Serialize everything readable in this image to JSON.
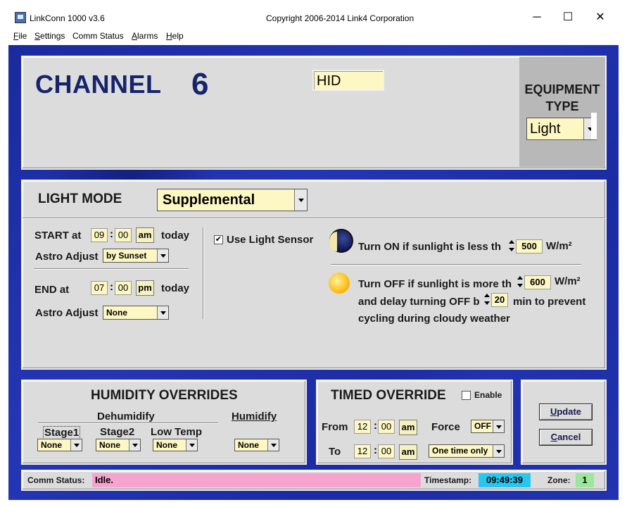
{
  "window": {
    "title": "LinkConn 1000 v3.6",
    "copyright": "Copyright 2006-2014 Link4 Corporation",
    "minimize": "─",
    "maximize": "☐",
    "close": "✕"
  },
  "menu": [
    {
      "label": "File",
      "key": "F",
      "rest": "ile"
    },
    {
      "label": "Settings",
      "key": "S",
      "rest": "ettings"
    },
    {
      "label": "Comm Status",
      "key": "",
      "rest": "Comm Status"
    },
    {
      "label": "Alarms",
      "key": "A",
      "rest": "larms"
    },
    {
      "label": "Help",
      "key": "H",
      "rest": "elp"
    }
  ],
  "channel": {
    "title": "CHANNEL",
    "number": "6",
    "name_value": "HID",
    "equipment_type_label_1": "EQUIPMENT",
    "equipment_type_label_2": "TYPE",
    "equipment_type_value": "Light"
  },
  "light_mode": {
    "label": "LIGHT MODE",
    "value": "Supplemental",
    "start": {
      "label": "START at",
      "hour": "09",
      "minute": "00",
      "ampm": "am",
      "suffix": "today",
      "astro_label": "Astro Adjust",
      "astro_value": "by Sunset"
    },
    "end": {
      "label": "END at",
      "hour": "07",
      "minute": "00",
      "ampm": "pm",
      "suffix": "today",
      "astro_label": "Astro Adjust",
      "astro_value": "None"
    },
    "sensor": {
      "checkbox_mark": "✔",
      "checked": true,
      "label": "Use Light Sensor",
      "on_text": "Turn ON if sunlight is less th",
      "on_value": "500",
      "on_unit": "W/m²",
      "off_text": "Turn OFF if sunlight is more th",
      "off_value": "600",
      "off_unit": "W/m²",
      "delay_text": "and delay turning OFF b",
      "delay_value": "20",
      "delay_suffix": "min to prevent",
      "delay_line2": "cycling during cloudy weather"
    }
  },
  "humidity": {
    "title": "HUMIDITY OVERRIDES",
    "dehumidify_label": "Dehumidify",
    "humidify_label": "Humidify",
    "stage1_label": "Stage1",
    "stage2_label": "Stage2",
    "lowtemp_label": "Low Temp",
    "stage1_value": "None",
    "stage2_value": "None",
    "lowtemp_value": "None",
    "humidify_value": "None"
  },
  "timed_override": {
    "title": "TIMED OVERRIDE",
    "enable_label": "Enable",
    "enabled": false,
    "from_label": "From",
    "from_hour": "12",
    "from_minute": "00",
    "from_ampm": "am",
    "to_label": "To",
    "to_hour": "12",
    "to_minute": "00",
    "to_ampm": "am",
    "force_label": "Force",
    "force_value": "OFF",
    "repeat_value": "One time only"
  },
  "actions": {
    "update_key": "U",
    "update_rest": "pdate",
    "cancel_key": "C",
    "cancel_rest": "ancel"
  },
  "status": {
    "comm_label": "Comm Status:",
    "comm_value": "Idle.",
    "timestamp_label": "Timestamp:",
    "timestamp_value": "09:49:39",
    "zone_label": "Zone:",
    "zone_value": "1"
  },
  "colors": {
    "client_bg": "#1f2fa8",
    "panel_bg": "#dcdcdc",
    "field_bg": "#fdf7c3",
    "comm_status_bg": "#f7a3cf",
    "timestamp_bg": "#29c7f0",
    "zone_bg": "#9be79b",
    "title_text": "#16246b"
  }
}
